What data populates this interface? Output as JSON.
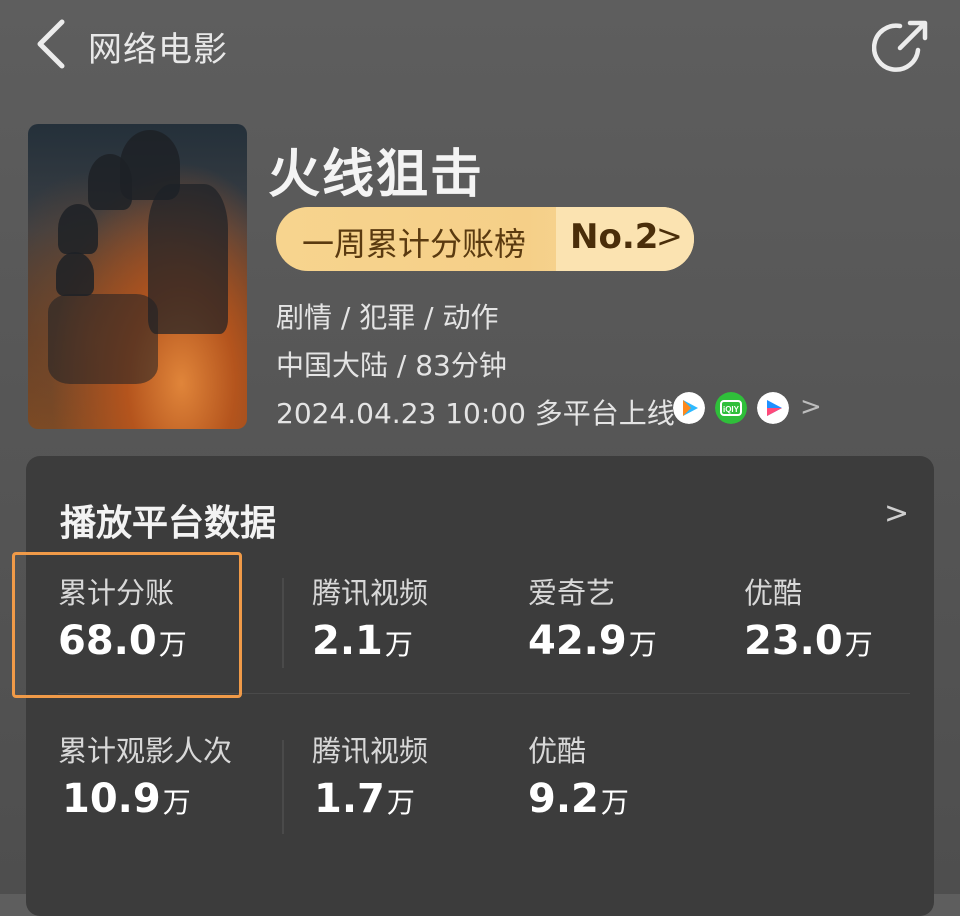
{
  "header": {
    "title": "网络电影",
    "back_icon": "chevron-left-icon",
    "share_icon": "share-icon"
  },
  "movie": {
    "title": "火线狙击",
    "rank": {
      "label": "一周累计分账榜",
      "number": "No.2",
      "arrow": ">"
    },
    "genres": "剧情 / 犯罪 / 动作",
    "region_runtime": "中国大陆 / 83分钟",
    "release": "2024.04.23 10:00 多平台上线",
    "platforms": [
      {
        "name": "tencent-video-icon",
        "color": "#2db9ff"
      },
      {
        "name": "iqiyi-icon",
        "color": "#2fbf3a"
      },
      {
        "name": "youku-icon",
        "color": "#1e90ff"
      }
    ],
    "platforms_arrow": ">"
  },
  "panel": {
    "title": "播放平台数据",
    "arrow": ">",
    "row1": [
      {
        "label": "累计分账",
        "value": "68.0",
        "unit": "万"
      },
      {
        "label": "腾讯视频",
        "value": "2.1",
        "unit": "万"
      },
      {
        "label": "爱奇艺",
        "value": "42.9",
        "unit": "万"
      },
      {
        "label": "优酷",
        "value": "23.0",
        "unit": "万"
      }
    ],
    "row2": [
      {
        "label": "累计观影人次",
        "value": "10.9",
        "unit": "万"
      },
      {
        "label": "腾讯视频",
        "value": "1.7",
        "unit": "万"
      },
      {
        "label": "优酷",
        "value": "9.2",
        "unit": "万"
      }
    ]
  },
  "colors": {
    "accent_pill": "#f7d48e",
    "highlight_box": "#f09a48",
    "panel_bg": "#3c3c3c"
  }
}
